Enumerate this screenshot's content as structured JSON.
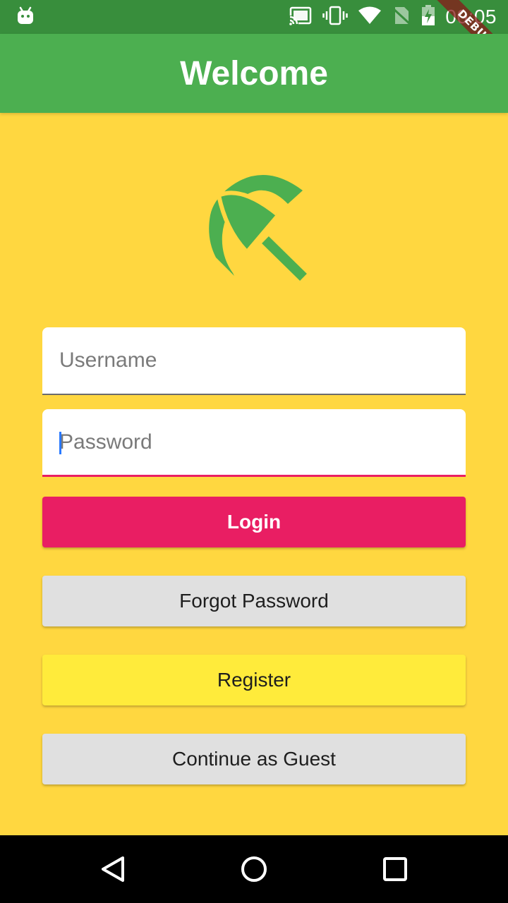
{
  "status_bar": {
    "time": "00:05",
    "icons": [
      "android-icon",
      "cast-icon",
      "vibrate-icon",
      "wifi-icon",
      "no-sim-icon",
      "battery-charging-icon"
    ]
  },
  "debug_banner": {
    "label": "DEBUG"
  },
  "app_bar": {
    "title": "Welcome"
  },
  "logo": {
    "icon": "beach-umbrella-icon",
    "color": "#4CAF50"
  },
  "form": {
    "username": {
      "placeholder": "Username",
      "value": ""
    },
    "password": {
      "placeholder": "Password",
      "value": ""
    }
  },
  "buttons": {
    "login": "Login",
    "forgot_password": "Forgot Password",
    "register": "Register",
    "guest": "Continue as Guest"
  },
  "colors": {
    "background": "#FFD740",
    "app_bar": "#4CAF50",
    "status_bar": "#388E3C",
    "accent": "#E91E63",
    "register_button": "#FFEB3B"
  },
  "nav_bar": {
    "icons": [
      "back-icon",
      "home-icon",
      "recents-icon"
    ]
  }
}
